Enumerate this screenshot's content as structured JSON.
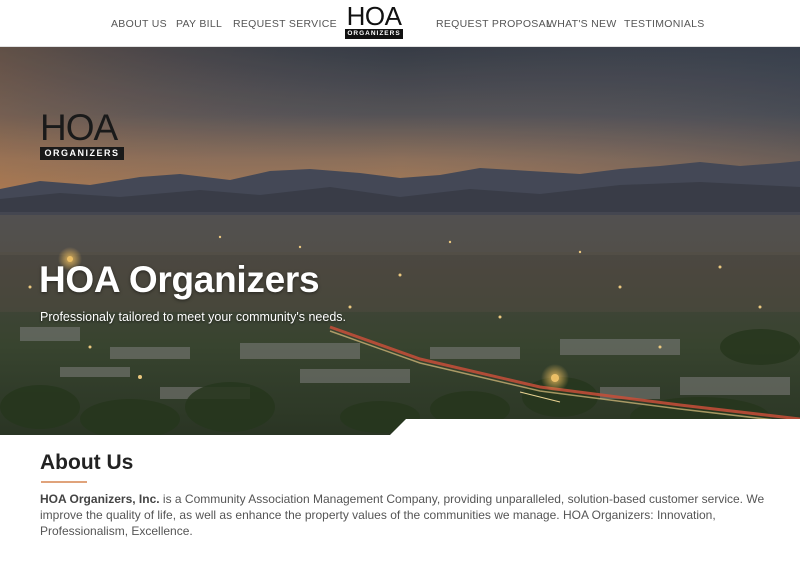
{
  "nav": {
    "left": [
      "ABOUT US",
      "PAY BILL",
      "REQUEST SERVICE"
    ],
    "right": [
      "REQUEST PROPOSAL",
      "WHAT'S NEW",
      "TESTIMONIALS"
    ],
    "logo": {
      "top": "HOA",
      "bottom": "ORGANIZERS"
    }
  },
  "hero": {
    "logo": {
      "top": "HOA",
      "bottom": "ORGANIZERS"
    },
    "title": "HOA Organizers",
    "subtitle": "Professionaly tailored to meet your community's needs."
  },
  "about": {
    "heading": "About Us",
    "company": "HOA Organizers, Inc.",
    "body": " is a Community Association Management Company, providing unparalleled, solution-based customer service. We improve the quality of life, as well as enhance the property values of the communities we manage. HOA Organizers: Innovation, Professionalism, Excellence."
  },
  "colors": {
    "accent_rule": "#e0a37b",
    "nav_text": "#555555",
    "hero_text": "#ffffff"
  }
}
